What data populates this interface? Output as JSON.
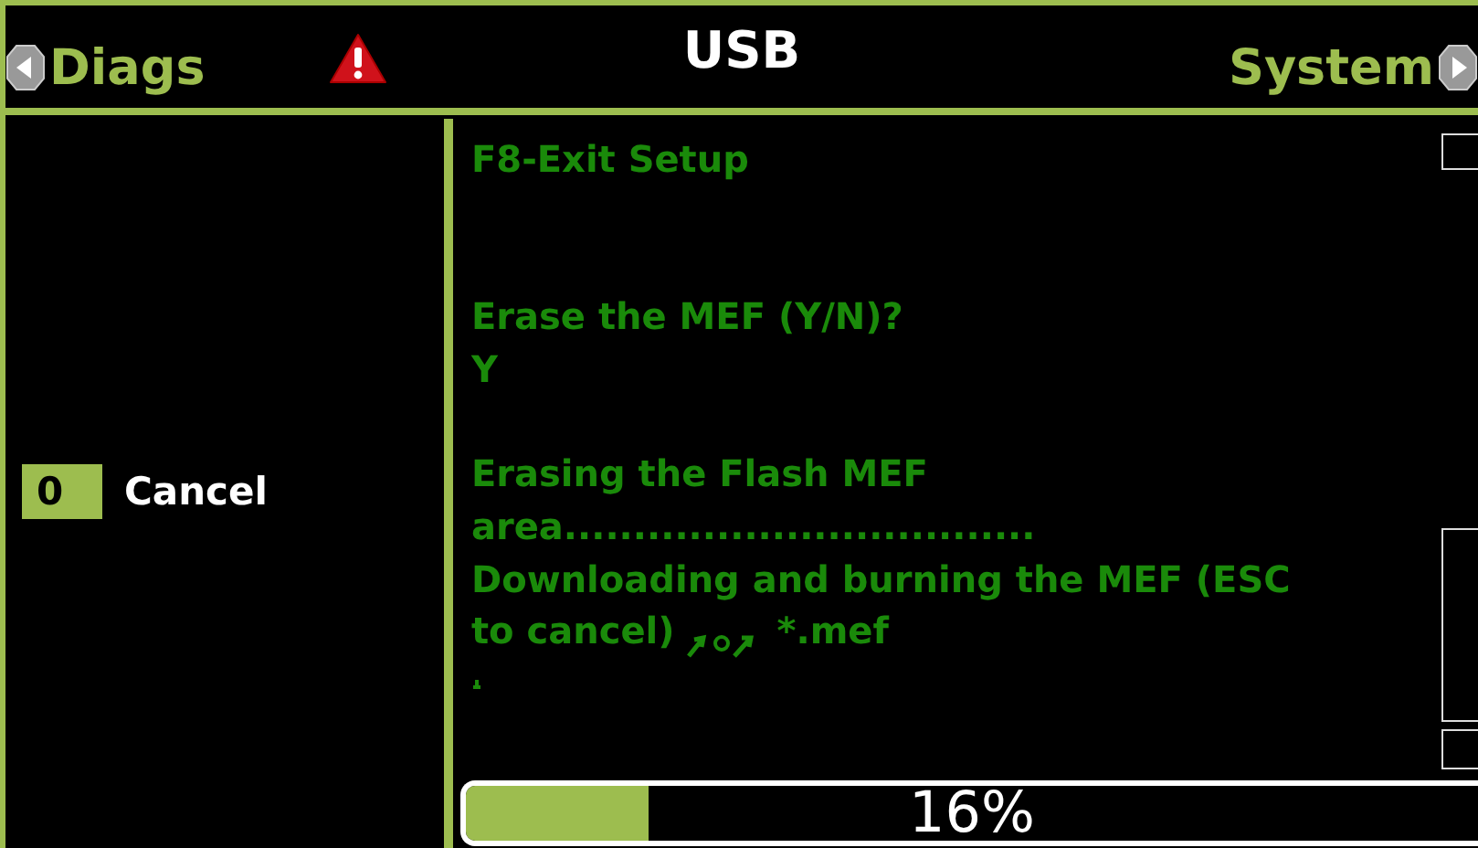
{
  "header": {
    "left_tab": "Diags",
    "title": "USB",
    "right_tab": "System",
    "warning": true
  },
  "softkeys": [
    {
      "key": "0",
      "label": "Cancel"
    }
  ],
  "terminal": {
    "lines": [
      {
        "text": "F8-Exit Setup"
      },
      {
        "kind": "blank"
      },
      {
        "kind": "blank"
      },
      {
        "text": "Erase the MEF (Y/N)?"
      },
      {
        "text": "Y"
      },
      {
        "kind": "blank"
      },
      {
        "text": "Erasing the Flash MEF"
      },
      {
        "text": "area.................................."
      },
      {
        "text": "Downloading and burning the MEF (ESC"
      },
      {
        "text": "to cancel)",
        "garbled": true,
        "tail": "*.mef"
      },
      {
        "kind": "text",
        "garbled": true
      }
    ]
  },
  "progress": {
    "level": 0.18,
    "reading": "16%"
  }
}
